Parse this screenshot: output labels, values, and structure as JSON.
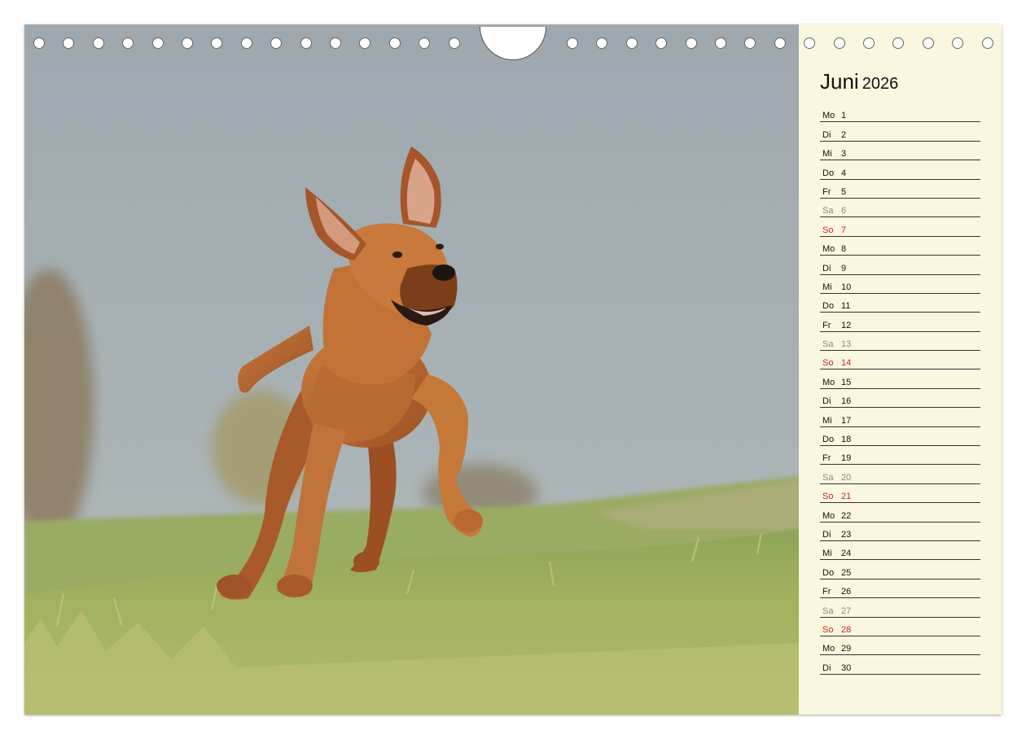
{
  "calendar": {
    "month": "Juni",
    "year": "2026",
    "days": [
      {
        "wd": "Mo",
        "num": "1",
        "type": "weekday"
      },
      {
        "wd": "Di",
        "num": "2",
        "type": "weekday"
      },
      {
        "wd": "Mi",
        "num": "3",
        "type": "weekday"
      },
      {
        "wd": "Do",
        "num": "4",
        "type": "weekday"
      },
      {
        "wd": "Fr",
        "num": "5",
        "type": "weekday"
      },
      {
        "wd": "Sa",
        "num": "6",
        "type": "sat"
      },
      {
        "wd": "So",
        "num": "7",
        "type": "sun"
      },
      {
        "wd": "Mo",
        "num": "8",
        "type": "weekday"
      },
      {
        "wd": "Di",
        "num": "9",
        "type": "weekday"
      },
      {
        "wd": "Mi",
        "num": "10",
        "type": "weekday"
      },
      {
        "wd": "Do",
        "num": "11",
        "type": "weekday"
      },
      {
        "wd": "Fr",
        "num": "12",
        "type": "weekday"
      },
      {
        "wd": "Sa",
        "num": "13",
        "type": "sat"
      },
      {
        "wd": "So",
        "num": "14",
        "type": "sun"
      },
      {
        "wd": "Mo",
        "num": "15",
        "type": "weekday"
      },
      {
        "wd": "Di",
        "num": "16",
        "type": "weekday"
      },
      {
        "wd": "Mi",
        "num": "17",
        "type": "weekday"
      },
      {
        "wd": "Do",
        "num": "18",
        "type": "weekday"
      },
      {
        "wd": "Fr",
        "num": "19",
        "type": "weekday"
      },
      {
        "wd": "Sa",
        "num": "20",
        "type": "sat"
      },
      {
        "wd": "So",
        "num": "21",
        "type": "sun"
      },
      {
        "wd": "Mo",
        "num": "22",
        "type": "weekday"
      },
      {
        "wd": "Di",
        "num": "23",
        "type": "weekday"
      },
      {
        "wd": "Mi",
        "num": "24",
        "type": "weekday"
      },
      {
        "wd": "Do",
        "num": "25",
        "type": "weekday"
      },
      {
        "wd": "Fr",
        "num": "26",
        "type": "weekday"
      },
      {
        "wd": "Sa",
        "num": "27",
        "type": "sat"
      },
      {
        "wd": "So",
        "num": "28",
        "type": "sun"
      },
      {
        "wd": "Mo",
        "num": "29",
        "type": "weekday"
      },
      {
        "wd": "Di",
        "num": "30",
        "type": "weekday"
      }
    ]
  },
  "colors": {
    "sidebar_bg": "#fbf6df",
    "sunday": "#c0282d",
    "saturday": "#888888",
    "sky": "#a3adb1",
    "grass": "#a8b661",
    "dog": "#b8642c"
  },
  "photo": {
    "subject": "running-dog-in-meadow"
  }
}
